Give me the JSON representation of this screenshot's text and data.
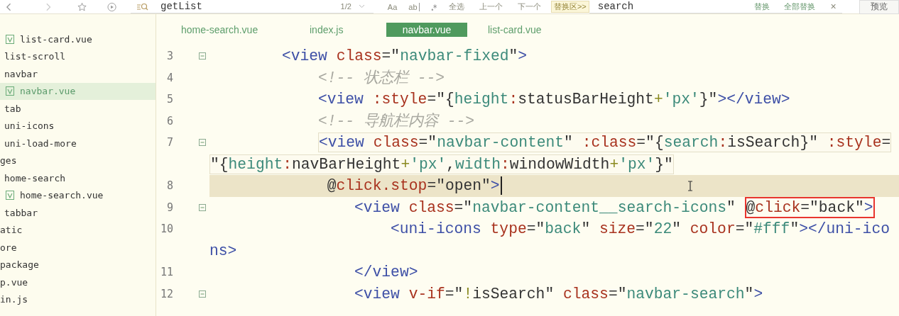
{
  "toolbar": {
    "search": {
      "value": "getList",
      "count": "1/2"
    },
    "case_option": "Aa",
    "word_option": "ab",
    "find_buttons": [
      "全选",
      "上一个",
      "下一个"
    ],
    "replace": {
      "toggle": "替换区>>",
      "value": "search",
      "buttons": [
        "替换",
        "全部替换"
      ],
      "close": "×"
    },
    "preview": "预览"
  },
  "sidebar": {
    "items": [
      {
        "kind": "continuation",
        "children": [
          {
            "kind": "continuation",
            "children": [
              {
                "label": "list-card.vue",
                "kind": "vue",
                "selected": false
              }
            ]
          },
          {
            "label": "list-scroll",
            "kind": "plain",
            "selected": false
          },
          {
            "label": "navbar",
            "kind": "plain",
            "selected": false,
            "children": [
              {
                "label": "navbar.vue",
                "kind": "vue",
                "selected": true
              }
            ]
          },
          {
            "label": "tab",
            "kind": "plain",
            "selected": false
          },
          {
            "label": "uni-icons",
            "kind": "plain",
            "selected": false
          },
          {
            "label": "uni-load-more",
            "kind": "plain",
            "selected": false
          }
        ]
      },
      {
        "label": "ges",
        "kind": "plain",
        "selected": false,
        "children": [
          {
            "label": "home-search",
            "kind": "plain",
            "selected": false,
            "children": [
              {
                "label": "home-search.vue",
                "kind": "vue",
                "selected": false
              }
            ]
          },
          {
            "label": "tabbar",
            "kind": "plain",
            "selected": false
          }
        ]
      },
      {
        "label": "atic",
        "kind": "plain",
        "selected": false
      },
      {
        "label": "ore",
        "kind": "plain",
        "selected": false
      },
      {
        "label": "package",
        "kind": "plain",
        "selected": false
      },
      {
        "label": "p.vue",
        "kind": "plain",
        "selected": false
      },
      {
        "label": "in.js",
        "kind": "plain",
        "selected": false
      }
    ]
  },
  "tabs": [
    {
      "label": "home-search.vue",
      "selected": false
    },
    {
      "label": "index.js",
      "selected": false
    },
    {
      "label": "navbar.vue",
      "selected": true
    },
    {
      "label": "list-card.vue",
      "selected": false
    }
  ],
  "editor": {
    "lines": [
      {
        "kind": "line",
        "number": "3",
        "fold": true,
        "current": false,
        "outlined": false,
        "tokens": [
          {
            "kind": "tag",
            "text": "<view "
          },
          {
            "kind": "attr",
            "text": "class"
          },
          {
            "kind": "punct",
            "text": "=\""
          },
          {
            "kind": "str",
            "text": "navbar-fixed"
          },
          {
            "kind": "punct",
            "text": "\""
          },
          {
            "kind": "tag",
            "text": ">"
          }
        ],
        "children": [
          {
            "kind": "line",
            "number": "4",
            "fold": false,
            "current": false,
            "outlined": false,
            "tokens": [
              {
                "kind": "comment",
                "text": "<!-- 状态栏 -->"
              }
            ]
          },
          {
            "kind": "line",
            "number": "5",
            "fold": false,
            "current": false,
            "outlined": false,
            "tokens": [
              {
                "kind": "tag",
                "text": "<view "
              },
              {
                "kind": "attr",
                "text": ":style"
              },
              {
                "kind": "punct",
                "text": "=\"{"
              },
              {
                "kind": "str",
                "text": "height"
              },
              {
                "kind": "attr",
                "text": ":"
              },
              {
                "kind": "punct",
                "text": "statusBarHeight"
              },
              {
                "kind": "op",
                "text": "+"
              },
              {
                "kind": "str",
                "text": "'px'"
              },
              {
                "kind": "punct",
                "text": "}\""
              },
              {
                "kind": "tag",
                "text": "></view>"
              }
            ]
          },
          {
            "kind": "line",
            "number": "6",
            "fold": false,
            "current": false,
            "outlined": false,
            "tokens": [
              {
                "kind": "comment",
                "text": "<!-- 导航栏内容 -->"
              }
            ]
          },
          {
            "kind": "line",
            "number": "7",
            "fold": true,
            "current": false,
            "outlined": true,
            "tokens": [
              {
                "kind": "tag",
                "text": "<view "
              },
              {
                "kind": "attr",
                "text": "class"
              },
              {
                "kind": "punct",
                "text": "=\""
              },
              {
                "kind": "str",
                "text": "navbar-content"
              },
              {
                "kind": "punct",
                "text": "\" "
              },
              {
                "kind": "attr",
                "text": ":class"
              },
              {
                "kind": "punct",
                "text": "=\"{"
              },
              {
                "kind": "str",
                "text": "search"
              },
              {
                "kind": "attr",
                "text": ":"
              },
              {
                "kind": "punct",
                "text": "isSearch}\" "
              },
              {
                "kind": "attr",
                "text": ":style"
              },
              {
                "kind": "punct",
                "text": "="
              }
            ],
            "children": [
              {
                "kind": "wrap",
                "current": false,
                "outlined": true,
                "tokens": [
                  {
                    "kind": "punct",
                    "text": "\"{"
                  },
                  {
                    "kind": "str",
                    "text": "height"
                  },
                  {
                    "kind": "attr",
                    "text": ":"
                  },
                  {
                    "kind": "punct",
                    "text": "navBarHeight"
                  },
                  {
                    "kind": "op",
                    "text": "+"
                  },
                  {
                    "kind": "str",
                    "text": "'px'"
                  },
                  {
                    "kind": "punct",
                    "text": ","
                  },
                  {
                    "kind": "str",
                    "text": "width"
                  },
                  {
                    "kind": "attr",
                    "text": ":"
                  },
                  {
                    "kind": "punct",
                    "text": "windowWidth"
                  },
                  {
                    "kind": "op",
                    "text": "+"
                  },
                  {
                    "kind": "str",
                    "text": "'px'"
                  },
                  {
                    "kind": "punct",
                    "text": "}\""
                  }
                ]
              },
              {
                "kind": "attribute",
                "number": "8",
                "fold": false,
                "current": true,
                "outlined": false,
                "tokens": [
                  {
                    "kind": "punct",
                    "text": "@"
                  },
                  {
                    "kind": "attr",
                    "text": "click.stop"
                  },
                  {
                    "kind": "punct",
                    "text": "=\"open\""
                  },
                  {
                    "kind": "tag",
                    "text": ">"
                  }
                ]
              },
              {
                "kind": "line",
                "number": "9",
                "fold": true,
                "current": false,
                "outlined": false,
                "tokens": [
                  {
                    "kind": "tag",
                    "text": "<view "
                  },
                  {
                    "kind": "attr",
                    "text": "class"
                  },
                  {
                    "kind": "punct",
                    "text": "=\""
                  },
                  {
                    "kind": "str",
                    "text": "navbar-content__search-icons"
                  },
                  {
                    "kind": "punct",
                    "text": "\" "
                  },
                  {
                    "kind": "punct",
                    "text": "@",
                    "boxed": true
                  },
                  {
                    "kind": "attr",
                    "text": "click",
                    "boxed": true
                  },
                  {
                    "kind": "punct",
                    "text": "=\"back\"",
                    "boxed": true
                  },
                  {
                    "kind": "tag",
                    "text": ">",
                    "boxed": true
                  }
                ],
                "children": [
                  {
                    "kind": "line",
                    "number": "10",
                    "fold": false,
                    "current": false,
                    "outlined": false,
                    "tokens": [
                      {
                        "kind": "tag",
                        "text": "<uni-icons "
                      },
                      {
                        "kind": "attr",
                        "text": "type"
                      },
                      {
                        "kind": "punct",
                        "text": "=\""
                      },
                      {
                        "kind": "str",
                        "text": "back"
                      },
                      {
                        "kind": "punct",
                        "text": "\" "
                      },
                      {
                        "kind": "attr",
                        "text": "size"
                      },
                      {
                        "kind": "punct",
                        "text": "=\""
                      },
                      {
                        "kind": "str",
                        "text": "22"
                      },
                      {
                        "kind": "punct",
                        "text": "\" "
                      },
                      {
                        "kind": "attr",
                        "text": "color"
                      },
                      {
                        "kind": "punct",
                        "text": "=\""
                      },
                      {
                        "kind": "str",
                        "text": "#fff"
                      },
                      {
                        "kind": "punct",
                        "text": "\""
                      },
                      {
                        "kind": "tag",
                        "text": "></uni-ico"
                      }
                    ]
                  },
                  {
                    "kind": "wrap",
                    "current": false,
                    "outlined": false,
                    "tokens": [
                      {
                        "kind": "tag",
                        "text": "ns>"
                      }
                    ]
                  }
                ]
              },
              {
                "kind": "line",
                "number": "11",
                "fold": false,
                "current": false,
                "outlined": false,
                "tokens": [
                  {
                    "kind": "tag",
                    "text": "</view>"
                  }
                ]
              },
              {
                "kind": "line",
                "number": "12",
                "fold": true,
                "current": false,
                "outlined": false,
                "tokens": [
                  {
                    "kind": "tag",
                    "text": "<view "
                  },
                  {
                    "kind": "attr",
                    "text": "v-if"
                  },
                  {
                    "kind": "punct",
                    "text": "=\""
                  },
                  {
                    "kind": "op",
                    "text": "!"
                  },
                  {
                    "kind": "punct",
                    "text": "isSearch\" "
                  },
                  {
                    "kind": "attr",
                    "text": "class"
                  },
                  {
                    "kind": "punct",
                    "text": "=\""
                  },
                  {
                    "kind": "str",
                    "text": "navbar-search"
                  },
                  {
                    "kind": "punct",
                    "text": "\""
                  },
                  {
                    "kind": "tag",
                    "text": ">"
                  }
                ]
              }
            ]
          }
        ]
      }
    ]
  }
}
